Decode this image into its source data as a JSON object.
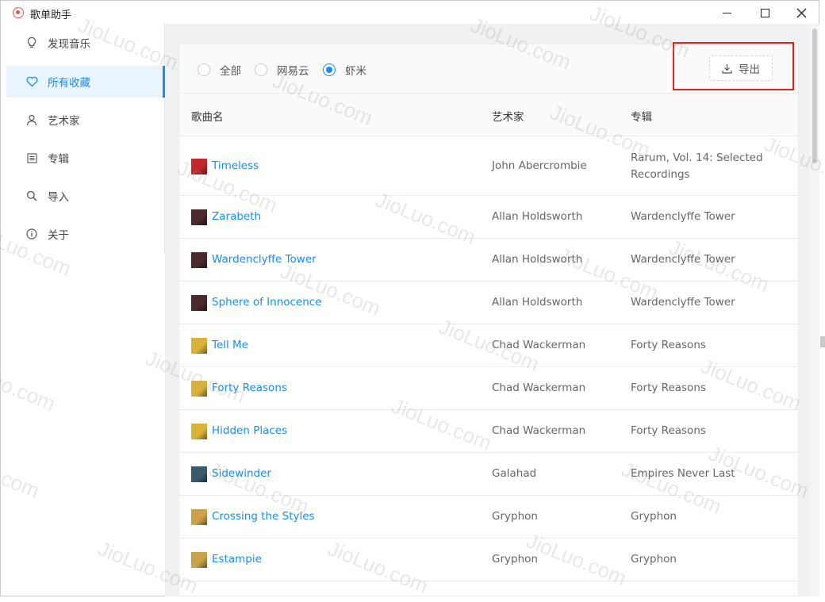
{
  "app": {
    "title": "歌单助手"
  },
  "sidebar": {
    "items": [
      {
        "label": "发现音乐",
        "icon": "bulb-icon",
        "active": false
      },
      {
        "label": "所有收藏",
        "icon": "heart-icon",
        "active": true
      },
      {
        "label": "艺术家",
        "icon": "user-icon",
        "active": false
      },
      {
        "label": "专辑",
        "icon": "album-icon",
        "active": false
      },
      {
        "label": "导入",
        "icon": "search-icon",
        "active": false
      },
      {
        "label": "关于",
        "icon": "info-icon",
        "active": false
      }
    ]
  },
  "filter": {
    "options": [
      {
        "label": "全部",
        "checked": false
      },
      {
        "label": "网易云",
        "checked": false
      },
      {
        "label": "虾米",
        "checked": true
      }
    ]
  },
  "toolbar": {
    "export_label": "导出"
  },
  "table": {
    "headers": {
      "song": "歌曲名",
      "artist": "艺术家",
      "album": "专辑"
    },
    "rows": [
      {
        "song": "Timeless",
        "artist": "John Abercrombie",
        "album": "Rarum, Vol. 14: Selected Recordings",
        "cover_color": "#c1272d"
      },
      {
        "song": "Zarabeth",
        "artist": "Allan Holdsworth",
        "album": "Wardenclyffe Tower",
        "cover_color": "#4a2a2a"
      },
      {
        "song": "Wardenclyffe Tower",
        "artist": "Allan Holdsworth",
        "album": "Wardenclyffe Tower",
        "cover_color": "#4a2a2a"
      },
      {
        "song": "Sphere of Innocence",
        "artist": "Allan Holdsworth",
        "album": "Wardenclyffe Tower",
        "cover_color": "#4a2a2a"
      },
      {
        "song": "Tell Me",
        "artist": "Chad Wackerman",
        "album": "Forty Reasons",
        "cover_color": "#d9b23a"
      },
      {
        "song": "Forty Reasons",
        "artist": "Chad Wackerman",
        "album": "Forty Reasons",
        "cover_color": "#d9b23a"
      },
      {
        "song": "Hidden Places",
        "artist": "Chad Wackerman",
        "album": "Forty Reasons",
        "cover_color": "#d9b23a"
      },
      {
        "song": "Sidewinder",
        "artist": "Galahad",
        "album": "Empires Never Last",
        "cover_color": "#3c5a6e"
      },
      {
        "song": "Crossing the Styles",
        "artist": "Gryphon",
        "album": "Gryphon",
        "cover_color": "#c9a24a"
      },
      {
        "song": "Estampie",
        "artist": "Gryphon",
        "album": "Gryphon",
        "cover_color": "#c9a24a"
      }
    ]
  },
  "watermark": "JioLuo.com",
  "colors": {
    "accent": "#1a8cf0",
    "highlight": "#e8211b"
  }
}
